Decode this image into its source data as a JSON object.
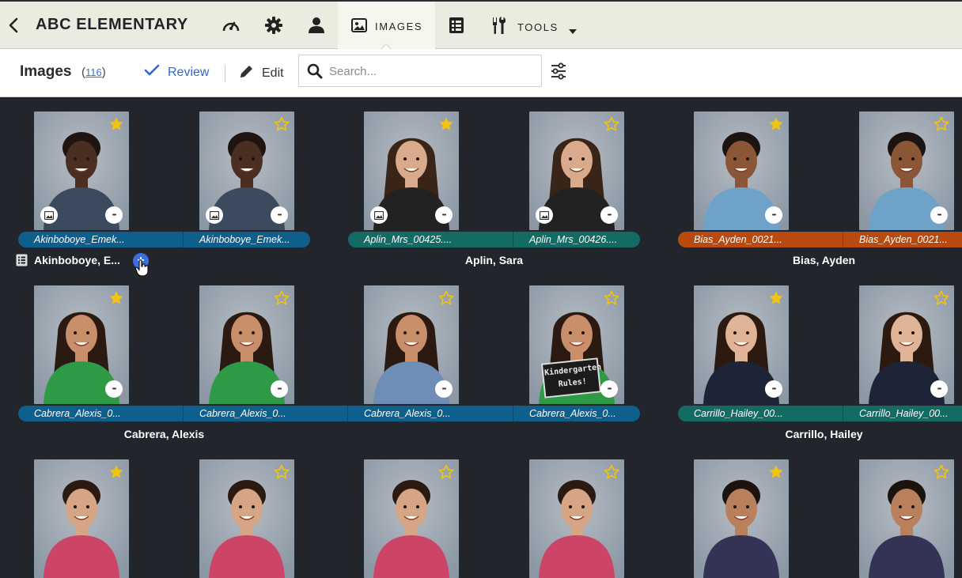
{
  "nav": {
    "school_name": "ABC ELEMENTARY",
    "images_tab": "IMAGES",
    "tools_tab": "TOOLS"
  },
  "toolbar": {
    "title": "Images",
    "count": "116",
    "review_label": "Review",
    "edit_label": "Edit",
    "search_placeholder": "Search..."
  },
  "rows": [
    {
      "photos": [
        {
          "label": "Akinboboye_Emek...",
          "starred": true
        },
        {
          "label": "Akinboboye_Emek...",
          "starred": false
        },
        {
          "label": "Aplin_Mrs_00425....",
          "starred": true
        },
        {
          "label": "Aplin_Mrs_00426....",
          "starred": false
        },
        {
          "label": "Bias_Ayden_0021...",
          "starred": true
        },
        {
          "label": "Bias_Ayden_0021...",
          "starred": false
        }
      ],
      "names": [
        "Akinboboye, E...",
        "Aplin, Sara",
        "Bias, Ayden"
      ]
    },
    {
      "photos": [
        {
          "label": "Cabrera_Alexis_0...",
          "starred": true
        },
        {
          "label": "Cabrera_Alexis_0...",
          "starred": false
        },
        {
          "label": "Cabrera_Alexis_0...",
          "starred": false
        },
        {
          "label": "Cabrera_Alexis_0...",
          "starred": false,
          "sign": "Kindergarten Rules!"
        },
        {
          "label": "Carrillo_Hailey_00...",
          "starred": true
        },
        {
          "label": "Carrillo_Hailey_00...",
          "starred": false
        }
      ],
      "names": [
        "Cabrera, Alexis",
        "Carrillo, Hailey"
      ]
    },
    {
      "photos": [
        {
          "starred": true
        },
        {
          "starred": false
        },
        {
          "starred": false
        },
        {
          "starred": false
        },
        {
          "starred": true
        },
        {
          "starred": false
        }
      ]
    }
  ],
  "colors": {
    "band_blue": "#0e5f8c",
    "band_teal": "#136b63",
    "band_orange": "#b94a0f",
    "star_gold": "#f2c40f",
    "accent_blue": "#2f67d6"
  },
  "icons": [
    "chevron-left-icon",
    "speedometer-icon",
    "gear-icon",
    "user-icon",
    "image-icon",
    "roster-icon",
    "tools-icon",
    "caret-down-icon",
    "check-icon",
    "pencil-icon",
    "search-icon",
    "filter-sliders-icon",
    "star-icon",
    "more-icon",
    "plus-icon",
    "pointer-hand-icon"
  ]
}
